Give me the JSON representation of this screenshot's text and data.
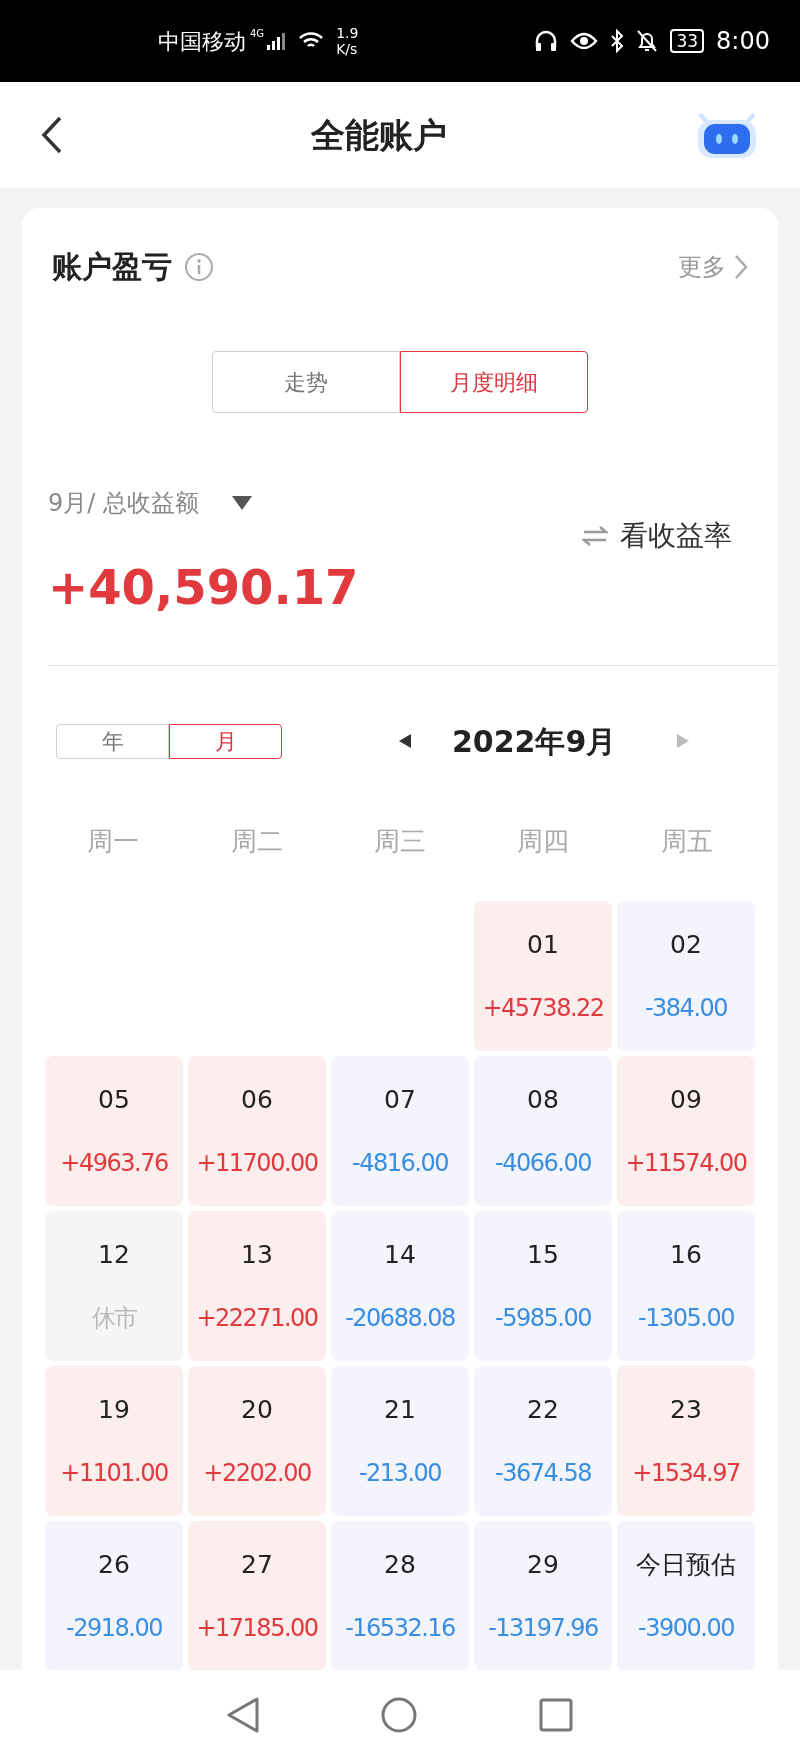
{
  "status_bar": {
    "carrier": "中国移动",
    "network": "4G",
    "speed_value": "1.9",
    "speed_unit": "K/s",
    "battery": "33",
    "time": "8:00"
  },
  "header": {
    "title": "全能账户"
  },
  "card": {
    "title": "账户盈亏",
    "more": "更多",
    "view_tabs": [
      {
        "label": "走势",
        "selected": false
      },
      {
        "label": "月度明细",
        "selected": true
      }
    ],
    "period_label": "9月/ 总收益额",
    "switch_label": "看收益率",
    "total": {
      "kind": "gain",
      "text": "+40,590.17"
    },
    "range_tabs": [
      {
        "label": "年",
        "selected": false
      },
      {
        "label": "月",
        "selected": true
      }
    ],
    "month": "2022年9月",
    "weekdays": [
      "周一",
      "周二",
      "周三",
      "周四",
      "周五"
    ],
    "weeks": [
      [
        {
          "kind": "empty"
        },
        {
          "kind": "empty"
        },
        {
          "kind": "empty"
        },
        {
          "kind": "gain",
          "day": "01",
          "value": "+45738.22"
        },
        {
          "kind": "loss",
          "day": "02",
          "value": "-384.00"
        }
      ],
      [
        {
          "kind": "gain",
          "day": "05",
          "value": "+4963.76"
        },
        {
          "kind": "gain",
          "day": "06",
          "value": "+11700.00"
        },
        {
          "kind": "loss",
          "day": "07",
          "value": "-4816.00"
        },
        {
          "kind": "loss",
          "day": "08",
          "value": "-4066.00"
        },
        {
          "kind": "gain",
          "day": "09",
          "value": "+11574.00"
        }
      ],
      [
        {
          "kind": "closed",
          "day": "12",
          "value": "休市"
        },
        {
          "kind": "gain",
          "day": "13",
          "value": "+22271.00"
        },
        {
          "kind": "loss",
          "day": "14",
          "value": "-20688.08"
        },
        {
          "kind": "loss",
          "day": "15",
          "value": "-5985.00"
        },
        {
          "kind": "loss",
          "day": "16",
          "value": "-1305.00"
        }
      ],
      [
        {
          "kind": "gain",
          "day": "19",
          "value": "+1101.00"
        },
        {
          "kind": "gain",
          "day": "20",
          "value": "+2202.00"
        },
        {
          "kind": "loss",
          "day": "21",
          "value": "-213.00"
        },
        {
          "kind": "loss",
          "day": "22",
          "value": "-3674.58"
        },
        {
          "kind": "gain",
          "day": "23",
          "value": "+1534.97"
        }
      ],
      [
        {
          "kind": "loss",
          "day": "26",
          "value": "-2918.00"
        },
        {
          "kind": "gain",
          "day": "27",
          "value": "+17185.00"
        },
        {
          "kind": "loss",
          "day": "28",
          "value": "-16532.16"
        },
        {
          "kind": "loss",
          "day": "29",
          "value": "-13197.96"
        },
        {
          "kind": "loss",
          "day": "今日预估",
          "value": "-3900.00"
        }
      ]
    ]
  }
}
